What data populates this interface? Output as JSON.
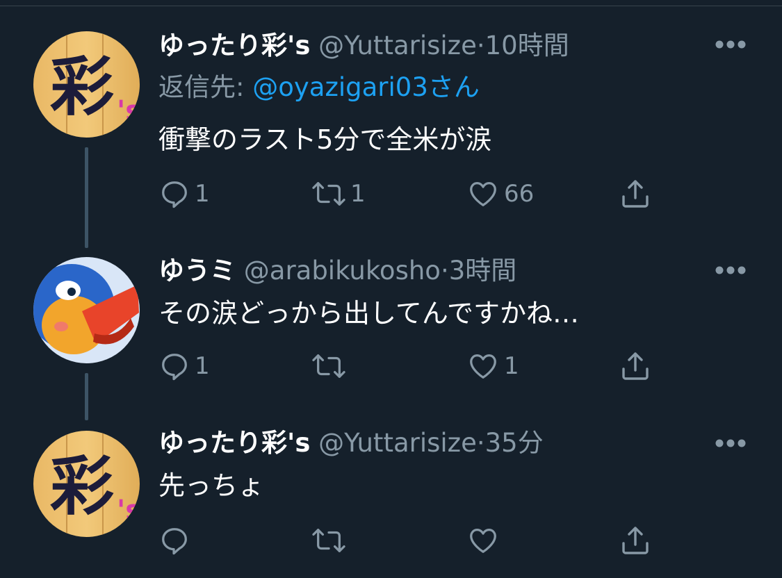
{
  "tweets": [
    {
      "name": "ゆったり彩's",
      "handle": "@Yuttarisize",
      "dot": "·",
      "time": "10時間",
      "reply_prefix": "返信先: ",
      "reply_mention": "@oyazigari03さん",
      "text": "衝撃のラスト5分で全米が涙",
      "avatar": {
        "text": "彩",
        "sub": "'s"
      },
      "counts": {
        "reply": "1",
        "retweet": "1",
        "like": "66"
      }
    },
    {
      "name": "ゆうミ",
      "handle": "@arabikukosho",
      "dot": "·",
      "time": "3時間",
      "text": "その涙どっから出してんですかね…",
      "avatar": {
        "text": "",
        "sub": ""
      },
      "counts": {
        "reply": "1",
        "retweet": "",
        "like": "1"
      }
    },
    {
      "name": "ゆったり彩's",
      "handle": "@Yuttarisize",
      "dot": "·",
      "time": "35分",
      "text": "先っちょ",
      "avatar": {
        "text": "彩",
        "sub": "'s"
      },
      "counts": {
        "reply": "",
        "retweet": "",
        "like": ""
      }
    }
  ],
  "icons": {
    "more": "more-dots-icon",
    "reply": "reply-icon",
    "retweet": "retweet-icon",
    "like": "heart-icon",
    "share": "share-icon"
  },
  "colors": {
    "background": "#15202b",
    "secondary_text": "#8899a6",
    "mention": "#1da1f2",
    "thread_line": "#3d5466"
  }
}
